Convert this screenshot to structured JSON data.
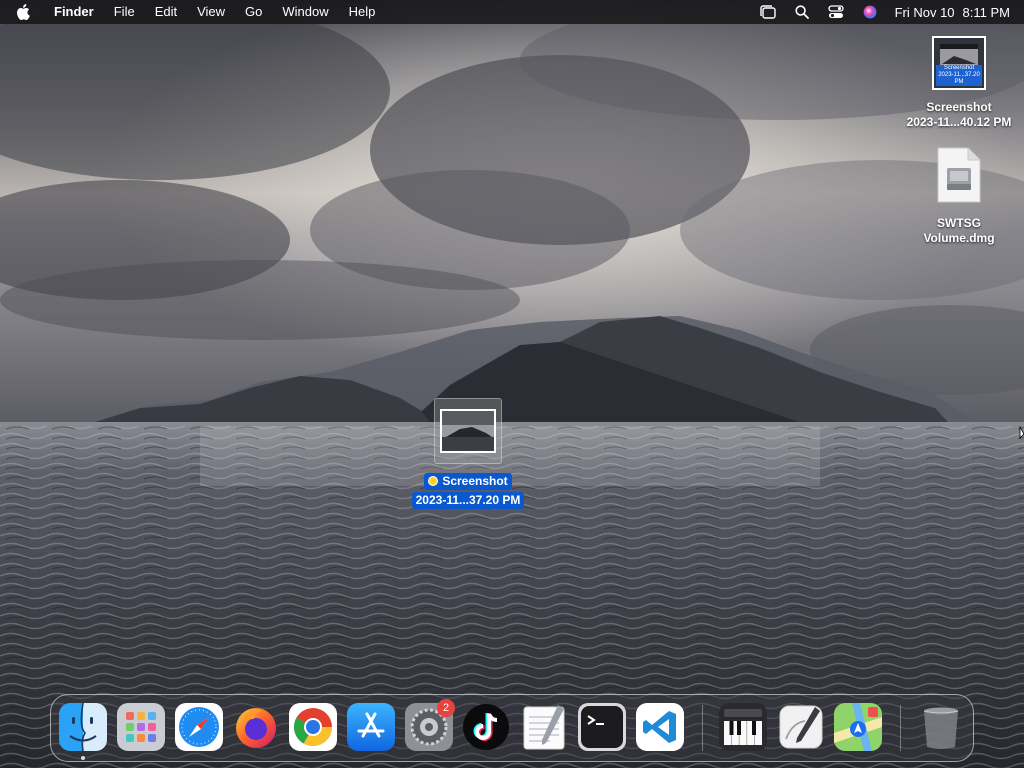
{
  "menubar": {
    "app_name": "Finder",
    "menus": [
      "File",
      "Edit",
      "View",
      "Go",
      "Window",
      "Help"
    ],
    "status_icons": [
      "stage-manager-icon",
      "spotlight-search-icon",
      "control-center-icon",
      "siri-icon"
    ],
    "clock": {
      "date": "Fri Nov 10",
      "time": "8:11 PM"
    }
  },
  "desktop": {
    "icons": [
      {
        "line1": "Screenshot",
        "line2": "2023-11...40.12 PM",
        "thumb_tag": "Screenshot",
        "thumb_tag2": "2023-11...37.20 PM"
      },
      {
        "line1": "SWTSG",
        "line2": "Volume.dmg"
      }
    ],
    "selected_icon": {
      "line1": "Screenshot",
      "line2": "2023-11...37.20 PM",
      "tag_color": "#ffd22e"
    }
  },
  "dock": {
    "apps": [
      {
        "name": "Finder",
        "icon": "finder-icon",
        "running": true
      },
      {
        "name": "Launchpad",
        "icon": "launchpad-icon"
      },
      {
        "name": "Safari",
        "icon": "safari-icon"
      },
      {
        "name": "Firefox",
        "icon": "firefox-icon"
      },
      {
        "name": "Google Chrome",
        "icon": "chrome-icon"
      },
      {
        "name": "App Store",
        "icon": "app-store-icon"
      },
      {
        "name": "System Settings",
        "icon": "system-settings-icon",
        "badge": "2"
      },
      {
        "name": "TikTok",
        "icon": "tiktok-icon"
      },
      {
        "name": "TextEdit",
        "icon": "textedit-icon"
      },
      {
        "name": "Terminal",
        "icon": "terminal-icon"
      },
      {
        "name": "Visual Studio Code",
        "icon": "vscode-icon"
      },
      {
        "name": "Piano",
        "icon": "piano-icon"
      },
      {
        "name": "Script Editor",
        "icon": "script-editor-icon"
      },
      {
        "name": "Maps",
        "icon": "maps-icon"
      },
      {
        "name": "Trash",
        "icon": "trash-icon"
      }
    ]
  },
  "colors": {
    "selection_blue": "#0a58d0",
    "badge_red": "#e8423a",
    "menubar_bg": "#161618"
  }
}
